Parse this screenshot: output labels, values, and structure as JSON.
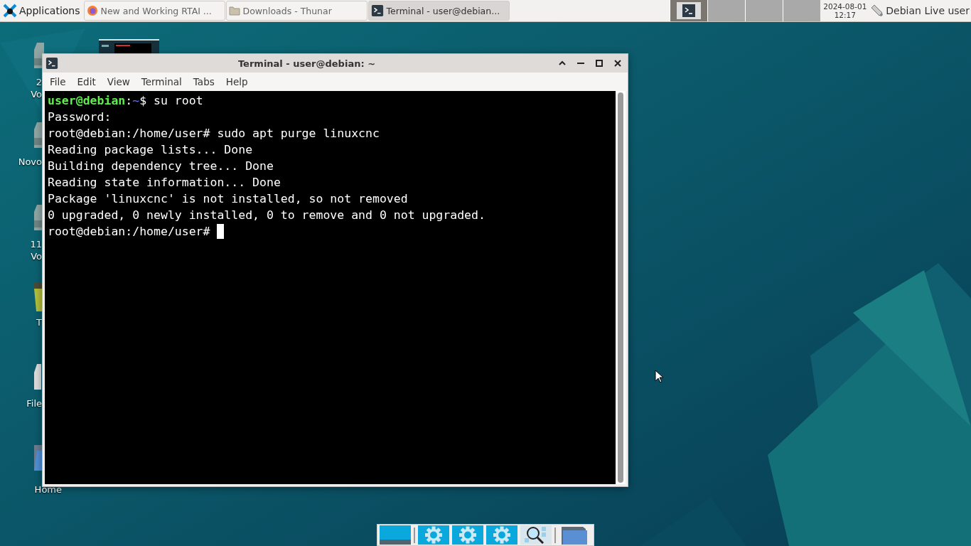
{
  "panel": {
    "apps_menu": {
      "label": "Applications"
    },
    "tasks": [
      {
        "label": "New and Working RTAI ...",
        "kind": "browser",
        "selected": false
      },
      {
        "label": "Downloads - Thunar",
        "kind": "folder",
        "selected": false
      },
      {
        "label": "Terminal - user@debian...",
        "kind": "terminal",
        "selected": true
      }
    ],
    "workspaces": [
      {
        "selected": true
      },
      {
        "selected": false
      },
      {
        "selected": false
      },
      {
        "selected": false
      }
    ],
    "clock": {
      "date": "2024-08-01",
      "time": "12:17"
    },
    "user": {
      "label": "Debian Live user"
    }
  },
  "desktop_icons": [
    {
      "kind": "drive",
      "label": [
        "2",
        "Vo"
      ]
    },
    {
      "kind": "drive",
      "label": [
        "Novo"
      ]
    },
    {
      "kind": "drive",
      "label": [
        "11",
        "Vo"
      ]
    },
    {
      "kind": "trash",
      "label": [
        "T"
      ]
    },
    {
      "kind": "filesystem",
      "label": [
        "File"
      ]
    },
    {
      "kind": "home",
      "label": [
        "Home"
      ]
    }
  ],
  "window": {
    "title": "Terminal - user@debian: ~",
    "menu": [
      "File",
      "Edit",
      "View",
      "Terminal",
      "Tabs",
      "Help"
    ],
    "lines": [
      [
        {
          "text": "user@debian",
          "kind": "user"
        },
        {
          "text": ":",
          "kind": "plain"
        },
        {
          "text": "~",
          "kind": "path"
        },
        {
          "text": "$ su root",
          "kind": "plain"
        }
      ],
      [
        {
          "text": "Password:",
          "kind": "plain"
        }
      ],
      [
        {
          "text": "root@debian:/home/user# sudo apt purge linuxcnc",
          "kind": "plain"
        }
      ],
      [
        {
          "text": "Reading package lists... Done",
          "kind": "plain"
        }
      ],
      [
        {
          "text": "Building dependency tree... Done",
          "kind": "plain"
        }
      ],
      [
        {
          "text": "Reading state information... Done",
          "kind": "plain"
        }
      ],
      [
        {
          "text": "Package 'linuxcnc' is not installed, so not removed",
          "kind": "plain"
        }
      ],
      [
        {
          "text": "0 upgraded, 0 newly installed, 0 to remove and 0 not upgraded.",
          "kind": "plain"
        }
      ],
      [
        {
          "text": "root@debian:/home/user# ",
          "kind": "plain"
        }
      ]
    ],
    "cursor": true
  },
  "dock": [
    {
      "kind": "desktop"
    },
    {
      "kind": "separator"
    },
    {
      "kind": "gear"
    },
    {
      "kind": "gear"
    },
    {
      "kind": "gear"
    },
    {
      "kind": "search"
    },
    {
      "kind": "separator"
    },
    {
      "kind": "folder"
    }
  ]
}
